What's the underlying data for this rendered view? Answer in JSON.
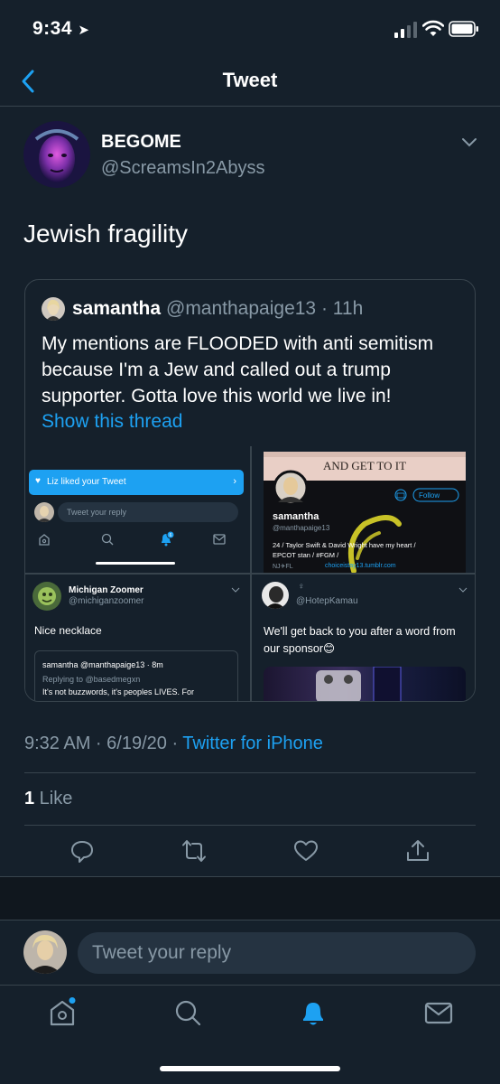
{
  "status_bar": {
    "time": "9:34"
  },
  "nav": {
    "title": "Tweet"
  },
  "tweet": {
    "author_name": "BEGOME",
    "author_handle": "@ScreamsIn2Abyss",
    "text": "Jewish fragility",
    "timestamp": "9:32 AM · 6/19/20 · ",
    "source": "Twitter for iPhone",
    "likes_count": "1",
    "likes_label": " Like"
  },
  "quoted": {
    "name": "samantha",
    "handle_time": "@manthapaige13 · 11h",
    "text": "My mentions are FLOODED with anti semitism because I'm a Jew and called out a trump supporter. Gotta love this world we live in!",
    "show_thread": "Show this thread",
    "media": {
      "cell1": {
        "liked_text": "Liz liked your Tweet",
        "reply_placeholder": "Tweet your reply",
        "badge": "6"
      },
      "cell2": {
        "banner_text": "AND GET TO IT",
        "follow": "Follow",
        "name": "samantha",
        "handle": "@manthapaige13",
        "bio1": "24 / Taylor Swift & David Wright have my heart /",
        "bio2": "EPCOT stan / #FGM /",
        "loc": "NJ✈FL",
        "link": "choiceistay13.tumblr.com"
      },
      "cell3": {
        "name": "Michigan Zoomer",
        "handle": "@michiganzoomer",
        "text": "Nice necklace",
        "quote_user": "samantha @manthapaige13 · 8m",
        "quote_reply": "Replying to @basedmegxn",
        "quote_text": "It's not buzzwords, it's peoples LIVES. For"
      },
      "cell4": {
        "handle": "@HotepKamau",
        "text": "We'll get back to you after a word from our sponsor😊"
      }
    }
  },
  "composer": {
    "placeholder": "Tweet your reply"
  },
  "colors": {
    "background": "#15202b",
    "accent": "#1da1f2",
    "muted": "#8899a6",
    "border": "#38444d"
  },
  "icons": [
    "back-icon",
    "caret-down-icon",
    "reply-icon",
    "retweet-icon",
    "like-icon",
    "share-icon",
    "home-icon",
    "search-icon",
    "notifications-icon",
    "messages-icon"
  ]
}
